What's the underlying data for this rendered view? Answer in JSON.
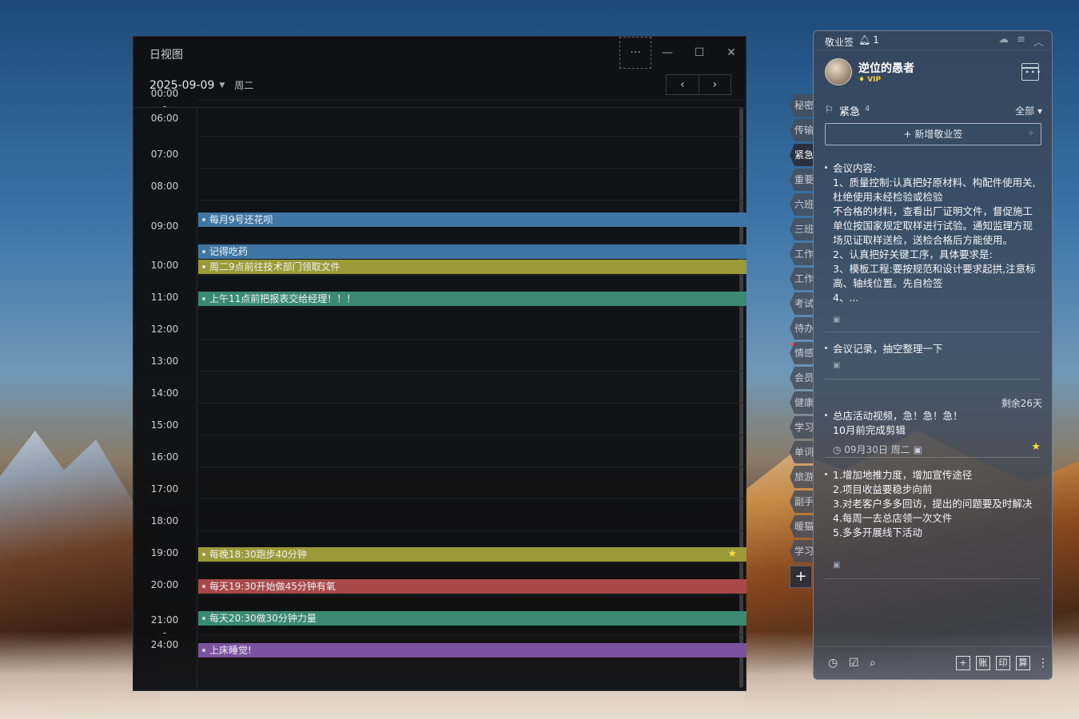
{
  "dayview": {
    "title": "日视图",
    "more_icon": "···",
    "minimize_icon": "—",
    "maximize_icon": "☐",
    "close_icon": "✕",
    "date": "2025-09-09",
    "weekday": "周二",
    "prev_icon": "‹",
    "next_icon": "›",
    "time_labels": [
      "00:00",
      "-",
      "06:00",
      "07:00",
      "08:00",
      "09:00",
      "10:00",
      "11:00",
      "12:00",
      "13:00",
      "14:00",
      "15:00",
      "16:00",
      "17:00",
      "18:00",
      "19:00",
      "20:00",
      "21:00",
      "-",
      "24:00"
    ],
    "events": [
      {
        "text": "每月9号还花呗",
        "color": "#3f76a6",
        "starred": false
      },
      {
        "text": "记得吃药",
        "color": "#3f76a6",
        "starred": false
      },
      {
        "text": "周二9点前往技术部门领取文件",
        "color": "#9a9a38",
        "starred": false
      },
      {
        "text": "上午11点前把报表交给经理！！！",
        "color": "#3a8a72",
        "starred": false
      },
      {
        "text": "每晚18:30跑步40分钟",
        "color": "#9a9a38",
        "starred": true
      },
      {
        "text": "每天19:30开始做45分钟有氧",
        "color": "#a84848",
        "starred": false
      },
      {
        "text": "每天20:30做30分钟力量",
        "color": "#3a8a72",
        "starred": false
      },
      {
        "text": "上床睡觉!",
        "color": "#7a52a0",
        "starred": false
      }
    ]
  },
  "tabs": [
    "秘密",
    "传输",
    "紧急",
    "重要",
    "六班",
    "三班",
    "工作",
    "工作",
    "考试",
    "待办",
    "情感",
    "会员",
    "健康",
    "学习",
    "单词",
    "旅游",
    "副手",
    "暖猫",
    "学习"
  ],
  "tab_add": "+",
  "panel": {
    "app_name": "敬业签",
    "bell_count": "1",
    "user_name": "逆位的愚者",
    "vip": "VIP",
    "category": "紧急",
    "category_count": "4",
    "filter": "全部",
    "add_note": "新增敬业签",
    "notes": [
      {
        "text": "会议内容:\n1、质量控制:认真把好原材料、构配件使用关,杜绝使用未经检验或检验\n不合格的材料，查看出厂证明文件，督促施工单位按国家规定取样进行试验。通知监理方现场见证取样送检，送检合格后方能使用。\n2、认真把好关键工序，具体要求是:\n3、模板工程:要按规范和设计要求起拱,注意标高、轴线位置。先自检签\n4、..."
      },
      {
        "text": "会议记录，抽空整理一下"
      },
      {
        "remain": "剩余26天",
        "text": "总店活动视频，急！急！急！\n10月前完成剪辑",
        "due": "09月30日 周二"
      },
      {
        "text": "1.增加地推力度，增加宣传途径\n2.项目收益要稳步向前\n3.对老客户多多回访，提出的问题要及时解决\n4.每周一去总店领一次文件\n5.多多开展线下活动"
      }
    ],
    "footer_boxes": [
      "+",
      "账",
      "印",
      "算"
    ]
  }
}
